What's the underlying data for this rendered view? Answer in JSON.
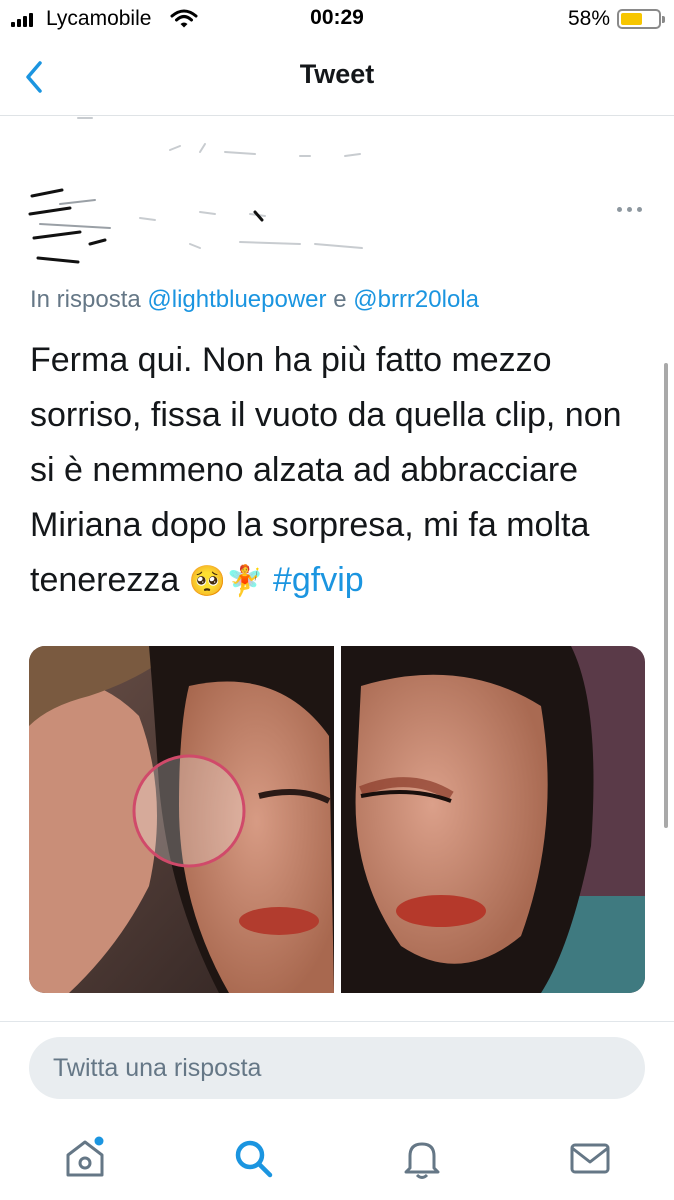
{
  "status_bar": {
    "carrier": "Lycamobile",
    "time": "00:29",
    "battery_percent": "58%",
    "battery_level": 0.58,
    "battery_color": "#f7c600"
  },
  "nav": {
    "title": "Tweet",
    "back_icon": "chevron-left-icon",
    "accent_color": "#1b95e0"
  },
  "tweet": {
    "more_icon": "ellipsis-icon",
    "reply_prefix": "In risposta",
    "reply_handle_1": "@lightbluepower",
    "reply_conjunction": "e",
    "reply_handle_2": "@brrr20lola",
    "text": "Ferma qui. Non ha più fatto mezzo sorriso, fissa il vuoto da quella clip, non si è nemmeno alzata ad abbracciare Miriana dopo la sorpresa, mi fa molta tenerezza",
    "emojis": "🥺🧚",
    "hashtag": "#gfvip",
    "media": [
      {
        "description": "photo-left"
      },
      {
        "description": "photo-right"
      }
    ]
  },
  "reply_bar": {
    "placeholder": "Twitta una risposta"
  },
  "tabbar": {
    "items": [
      {
        "icon": "home-icon",
        "has_badge": true
      },
      {
        "icon": "search-icon",
        "active": true
      },
      {
        "icon": "bell-icon"
      },
      {
        "icon": "mail-icon"
      }
    ]
  }
}
